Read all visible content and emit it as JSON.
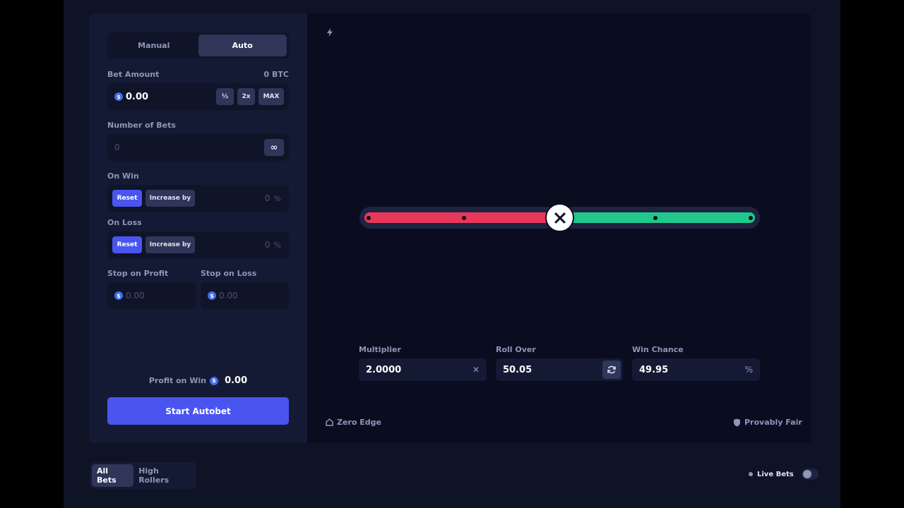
{
  "mode_tabs": [
    "Manual",
    "Auto"
  ],
  "active_mode": "Auto",
  "bet_amount": {
    "label": "Bet Amount",
    "balance": "0 BTC",
    "currency_icon": "$",
    "value": "0.00",
    "half_label": "½",
    "double_label": "2x",
    "max_label": "MAX"
  },
  "number_of_bets": {
    "label": "Number of Bets",
    "placeholder": "0",
    "infinite_label": "∞"
  },
  "on_win": {
    "label": "On Win",
    "reset_label": "Reset",
    "increase_label": "Increase by",
    "value": "0",
    "unit": "%"
  },
  "on_loss": {
    "label": "On Loss",
    "reset_label": "Reset",
    "increase_label": "Increase by",
    "value": "0",
    "unit": "%"
  },
  "stop_on_profit": {
    "label": "Stop on Profit",
    "placeholder": "0.00"
  },
  "stop_on_loss": {
    "label": "Stop on Loss",
    "placeholder": "0.00"
  },
  "profit_on_win": {
    "label": "Profit on Win",
    "value": "0.00"
  },
  "start_button": "Start Autobet",
  "slider": {
    "roll_over": 50.05,
    "marks": [
      0,
      25,
      50,
      75,
      100
    ],
    "lose_color": "#e93759",
    "win_color": "#20c98b"
  },
  "multiplier": {
    "label": "Multiplier",
    "value": "2.0000",
    "icon": "close-icon"
  },
  "roll_over": {
    "label": "Roll Over",
    "value": "50.05",
    "icon": "refresh-icon"
  },
  "win_chance": {
    "label": "Win Chance",
    "value": "49.95",
    "unit": "%"
  },
  "zero_edge": "Zero Edge",
  "provably_fair": "Provably Fair",
  "bet_tabs": [
    "All Bets",
    "High Rollers"
  ],
  "live_bets": "Live Bets"
}
